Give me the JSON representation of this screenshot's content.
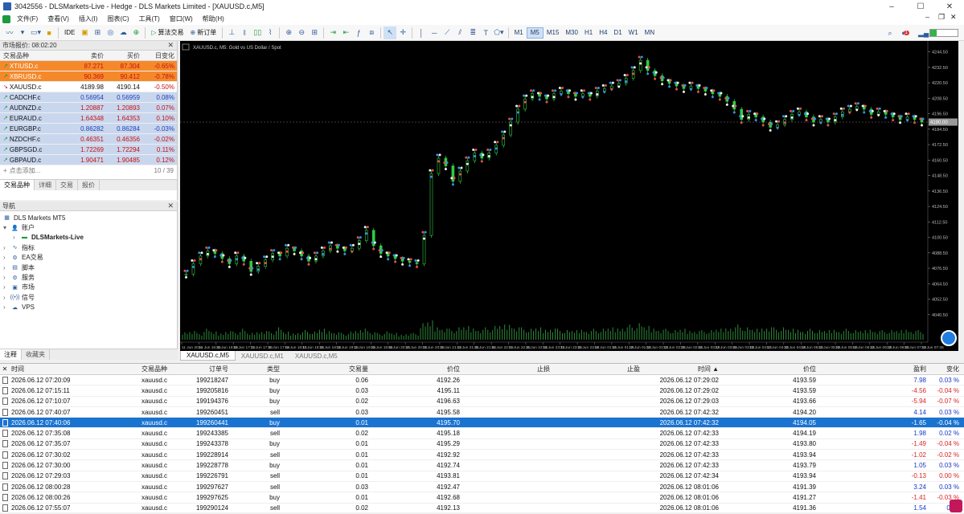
{
  "window": {
    "title": "3042556 - DLSMarkets-Live - Hedge - DLS Markets Limited - [XAUUSD.c,M5]",
    "controls": [
      "–",
      "☐",
      "✕"
    ]
  },
  "menu": [
    "文件(F)",
    "查看(V)",
    "插入(I)",
    "图表(C)",
    "工具(T)",
    "窗口(W)",
    "帮助(H)"
  ],
  "toolbar": {
    "ide": "IDE",
    "algo_trading": "算法交易",
    "new_order": "新订单",
    "timeframes": [
      "M1",
      "M5",
      "M15",
      "M30",
      "H1",
      "H4",
      "D1",
      "W1",
      "MN"
    ],
    "active_timeframe": "M5",
    "notification_count": "1"
  },
  "market_watch": {
    "title": "市场报价: 08:02:20",
    "columns": {
      "symbol": "交易品种",
      "bid": "卖价",
      "ask": "买价",
      "change": "日变化"
    },
    "rows": [
      {
        "symbol": "XTIUSD.c",
        "bid": "87.271",
        "ask": "87.304",
        "change": "-0.65%",
        "dir": "up",
        "bg": "#f5892a",
        "fg": "#c81010"
      },
      {
        "symbol": "XBRUSD.c",
        "bid": "90.369",
        "ask": "90.412",
        "change": "-0.78%",
        "dir": "up",
        "bg": "#f5892a",
        "fg": "#c81010"
      },
      {
        "symbol": "XAUUSD.c",
        "bid": "4189.98",
        "ask": "4190.14",
        "change": "-0.50%",
        "dir": "down",
        "bg": "#ffffff",
        "fg": "#111111"
      },
      {
        "symbol": "CADCHF.c",
        "bid": "0.56954",
        "ask": "0.56959",
        "change": "0.08%",
        "dir": "up",
        "bg": "#c9d7ee",
        "fg": "#1c3fb8"
      },
      {
        "symbol": "AUDNZD.c",
        "bid": "1.20887",
        "ask": "1.20893",
        "change": "0.07%",
        "dir": "up",
        "bg": "#c9d7ee",
        "fg": "#c81010"
      },
      {
        "symbol": "EURAUD.c",
        "bid": "1.64348",
        "ask": "1.64353",
        "change": "0.10%",
        "dir": "up",
        "bg": "#c9d7ee",
        "fg": "#c81010"
      },
      {
        "symbol": "EURGBP.c",
        "bid": "0.86282",
        "ask": "0.86284",
        "change": "-0.03%",
        "dir": "up",
        "bg": "#c9d7ee",
        "fg": "#1c3fb8"
      },
      {
        "symbol": "NZDCHF.c",
        "bid": "0.46351",
        "ask": "0.46356",
        "change": "-0.02%",
        "dir": "up",
        "bg": "#c9d7ee",
        "fg": "#c81010"
      },
      {
        "symbol": "GBPSGD.c",
        "bid": "1.72269",
        "ask": "1.72294",
        "change": "0.11%",
        "dir": "up",
        "bg": "#c9d7ee",
        "fg": "#c81010"
      },
      {
        "symbol": "GBPAUD.c",
        "bid": "1.90471",
        "ask": "1.90485",
        "change": "0.12%",
        "dir": "up",
        "bg": "#c9d7ee",
        "fg": "#c81010"
      }
    ],
    "add_placeholder": "点击添加...",
    "count": "10 / 39",
    "tabs": [
      "交易品种",
      "详细",
      "交易",
      "报价"
    ]
  },
  "navigator": {
    "title": "导航",
    "items": [
      {
        "label": "DLS Markets MT5",
        "level": 0,
        "bold": false,
        "icon": "platform-icon"
      },
      {
        "label": "账户",
        "level": 1,
        "bold": false,
        "icon": "accounts-icon"
      },
      {
        "label": "DLSMarkets-Live",
        "level": 2,
        "bold": true,
        "icon": "server-icon"
      },
      {
        "label": "指标",
        "level": 1,
        "bold": false,
        "icon": "indicators-icon"
      },
      {
        "label": "EA交易",
        "level": 1,
        "bold": false,
        "icon": "expert-advisors-icon"
      },
      {
        "label": "脚本",
        "level": 1,
        "bold": false,
        "icon": "scripts-icon"
      },
      {
        "label": "服务",
        "level": 1,
        "bold": false,
        "icon": "services-icon"
      },
      {
        "label": "市场",
        "level": 1,
        "bold": false,
        "icon": "market-icon"
      },
      {
        "label": "信号",
        "level": 1,
        "bold": false,
        "icon": "signals-icon"
      },
      {
        "label": "VPS",
        "level": 1,
        "bold": false,
        "icon": "vps-icon"
      }
    ],
    "tabs": [
      "注释",
      "收藏夹"
    ]
  },
  "chart": {
    "header": "XAUUSD.c, M5:  Gold vs US Dollar / Spot",
    "current_price": "4190.00",
    "tabs": [
      "XAUUSD.c,M5",
      "XAUUSD.c,M1",
      "XAUUSD.c,M5"
    ],
    "active_tab": 0
  },
  "chart_data": {
    "type": "line",
    "title": "XAUUSD.c, M5:  Gold vs US Dollar / Spot",
    "y_ticks": [
      "4244.50",
      "4232.50",
      "4220.50",
      "4208.50",
      "4196.50",
      "4184.50",
      "4172.50",
      "4160.50",
      "4148.50",
      "4136.50",
      "4124.50",
      "4112.50",
      "4100.50",
      "4088.50",
      "4076.50",
      "4064.50",
      "4052.50",
      "4040.50"
    ],
    "x_ticks": [
      "11 Jun 2026",
      "11 Jun 16:35",
      "11 Jun 16:55",
      "11 Jun 17:15",
      "11 Jun 17:35",
      "11 Jun 17:55",
      "11 Jun 18:15",
      "11 Jun 18:35",
      "11 Jun 18:55",
      "11 Jun 19:15",
      "11 Jun 19:35",
      "11 Jun 19:55",
      "11 Jun 20:15",
      "11 Jun 20:35",
      "11 Jun 20:55",
      "11 Jun 21:15",
      "11 Jun 21:35",
      "11 Jun 21:55",
      "11 Jun 22:15",
      "11 Jun 22:35",
      "11 Jun 22:55",
      "11 Jun 23:15",
      "11 Jun 23:35",
      "11 Jun 23:55",
      "12 Jun 01:15",
      "12 Jun 01:35",
      "12 Jun 01:55",
      "12 Jun 02:15",
      "12 Jun 02:35",
      "12 Jun 02:55",
      "12 Jun 03:15",
      "12 Jun 03:35",
      "12 Jun 03:55",
      "12 Jun 04:15",
      "12 Jun 04:35",
      "12 Jun 04:55",
      "12 Jun 05:15",
      "12 Jun 05:35",
      "12 Jun 05:55",
      "12 Jun 06:15",
      "12 Jun 06:35",
      "12 Jun 06:55",
      "12 Jun 07:15",
      "12 Jun 07:35"
    ],
    "ylim": [
      4036,
      4248
    ],
    "series": [
      {
        "values": [
          4072,
          4080,
          4086,
          4090,
          4088,
          4084,
          4080,
          4086,
          4082,
          4074,
          4078,
          4083,
          4088,
          4086,
          4092,
          4090,
          4086,
          4082,
          4086,
          4090,
          4094,
          4092,
          4090,
          4092,
          4098,
          4106,
          4094,
          4088,
          4086,
          4084,
          4082,
          4081,
          4080,
          4102,
          4150,
          4162,
          4156,
          4144,
          4152,
          4160,
          4166,
          4162,
          4166,
          4172,
          4180,
          4190,
          4200,
          4208,
          4212,
          4210,
          4208,
          4212,
          4214,
          4212,
          4210,
          4212,
          4210,
          4214,
          4216,
          4218,
          4220,
          4224,
          4230,
          4238,
          4230,
          4226,
          4222,
          4220,
          4218,
          4216,
          4218,
          4216,
          4214,
          4212,
          4210,
          4206,
          4200,
          4192,
          4196,
          4194,
          4190,
          4186,
          4188,
          4192,
          4196,
          4198,
          4194,
          4190,
          4192,
          4190,
          4194,
          4198,
          4200,
          4202,
          4200,
          4196,
          4198,
          4196,
          4194,
          4192,
          4194,
          4192,
          4190
        ]
      }
    ],
    "volume": [
      6,
      7,
      5,
      8,
      6,
      5,
      7,
      6,
      8,
      5,
      6,
      7,
      6,
      9,
      6,
      5,
      6,
      7,
      6,
      8,
      7,
      6,
      5,
      6,
      7,
      9,
      6,
      5,
      6,
      5,
      4,
      5,
      5,
      12,
      14,
      10,
      9,
      8,
      9,
      10,
      9,
      8,
      9,
      10,
      11,
      12,
      10,
      9,
      8,
      9,
      8,
      9,
      8,
      7,
      7,
      8,
      7,
      8,
      8,
      9,
      9,
      10,
      11,
      12,
      10,
      9,
      8,
      8,
      7,
      8,
      7,
      7,
      7,
      7,
      8,
      9,
      10,
      11,
      9,
      8,
      9,
      10,
      9,
      9,
      8,
      8,
      7,
      8,
      7,
      7,
      8,
      7,
      8,
      7,
      7,
      8,
      7,
      7,
      7,
      7,
      8,
      7,
      7
    ]
  },
  "trades": {
    "columns": {
      "time": "时间",
      "symbol": "交易品种",
      "ticket": "订单号",
      "type": "类型",
      "volume": "交易量",
      "price": "价位",
      "sl": "止损",
      "tp": "止盈",
      "close_time": "时间",
      "close_price": "价位",
      "profit": "盈利",
      "change": "变化"
    },
    "rows": [
      {
        "time": "2026.06.12 07:20:09",
        "symbol": "xauusd.c",
        "ticket": "199218247",
        "type": "buy",
        "volume": "0.06",
        "price": "4192.26",
        "close_time": "2026.06.12 07:29:02",
        "close_price": "4193.59",
        "profit": "7.98",
        "change": "0.03 %",
        "pos": true
      },
      {
        "time": "2026.06.12 07:15:11",
        "symbol": "xauusd.c",
        "ticket": "199205816",
        "type": "buy",
        "volume": "0.03",
        "price": "4195.11",
        "close_time": "2026.06.12 07:29:02",
        "close_price": "4193.59",
        "profit": "-4.56",
        "change": "-0.04 %",
        "pos": false
      },
      {
        "time": "2026.06.12 07:10:07",
        "symbol": "xauusd.c",
        "ticket": "199194376",
        "type": "buy",
        "volume": "0.02",
        "price": "4196.63",
        "close_time": "2026.06.12 07:29:03",
        "close_price": "4193.66",
        "profit": "-5.94",
        "change": "-0.07 %",
        "pos": false
      },
      {
        "time": "2026.06.12 07:40:07",
        "symbol": "xauusd.c",
        "ticket": "199260451",
        "type": "sell",
        "volume": "0.03",
        "price": "4195.58",
        "close_time": "2026.06.12 07:42:32",
        "close_price": "4194.20",
        "profit": "4.14",
        "change": "0.03 %",
        "pos": true
      },
      {
        "time": "2026.06.12 07:40:06",
        "symbol": "xauusd.c",
        "ticket": "199260441",
        "type": "buy",
        "volume": "0.01",
        "price": "4195.70",
        "close_time": "2026.06.12 07:42:32",
        "close_price": "4194.05",
        "profit": "-1.65",
        "change": "-0.04 %",
        "pos": false,
        "selected": true
      },
      {
        "time": "2026.06.12 07:35:08",
        "symbol": "xauusd.c",
        "ticket": "199243385",
        "type": "sell",
        "volume": "0.02",
        "price": "4195.18",
        "close_time": "2026.06.12 07:42:33",
        "close_price": "4194.19",
        "profit": "1.98",
        "change": "0.02 %",
        "pos": true
      },
      {
        "time": "2026.06.12 07:35:07",
        "symbol": "xauusd.c",
        "ticket": "199243378",
        "type": "buy",
        "volume": "0.01",
        "price": "4195.29",
        "close_time": "2026.06.12 07:42:33",
        "close_price": "4193.80",
        "profit": "-1.49",
        "change": "-0.04 %",
        "pos": false
      },
      {
        "time": "2026.06.12 07:30:02",
        "symbol": "xauusd.c",
        "ticket": "199228914",
        "type": "sell",
        "volume": "0.01",
        "price": "4192.92",
        "close_time": "2026.06.12 07:42:33",
        "close_price": "4193.94",
        "profit": "-1.02",
        "change": "-0.02 %",
        "pos": false
      },
      {
        "time": "2026.06.12 07:30:00",
        "symbol": "xauusd.c",
        "ticket": "199228778",
        "type": "buy",
        "volume": "0.01",
        "price": "4192.74",
        "close_time": "2026.06.12 07:42:33",
        "close_price": "4193.79",
        "profit": "1.05",
        "change": "0.03 %",
        "pos": true
      },
      {
        "time": "2026.06.12 07:29:03",
        "symbol": "xauusd.c",
        "ticket": "199226791",
        "type": "sell",
        "volume": "0.01",
        "price": "4193.81",
        "close_time": "2026.06.12 07:42:34",
        "close_price": "4193.94",
        "profit": "-0.13",
        "change": "0.00 %",
        "pos": false
      },
      {
        "time": "2026.06.12 08:00:28",
        "symbol": "xauusd.c",
        "ticket": "199297627",
        "type": "sell",
        "volume": "0.03",
        "price": "4192.47",
        "close_time": "2026.06.12 08:01:06",
        "close_price": "4191.39",
        "profit": "3.24",
        "change": "0.03 %",
        "pos": true
      },
      {
        "time": "2026.06.12 08:00:26",
        "symbol": "xauusd.c",
        "ticket": "199297625",
        "type": "buy",
        "volume": "0.01",
        "price": "4192.68",
        "close_time": "2026.06.12 08:01:06",
        "close_price": "4191.27",
        "profit": "-1.41",
        "change": "-0.03 %",
        "pos": false
      },
      {
        "time": "2026.06.12 07:55:07",
        "symbol": "xauusd.c",
        "ticket": "199290124",
        "type": "sell",
        "volume": "0.02",
        "price": "4192.13",
        "close_time": "2026.06.12 08:01:06",
        "close_price": "4191.36",
        "profit": "1.54",
        "change": "0.02",
        "pos": true
      }
    ]
  }
}
